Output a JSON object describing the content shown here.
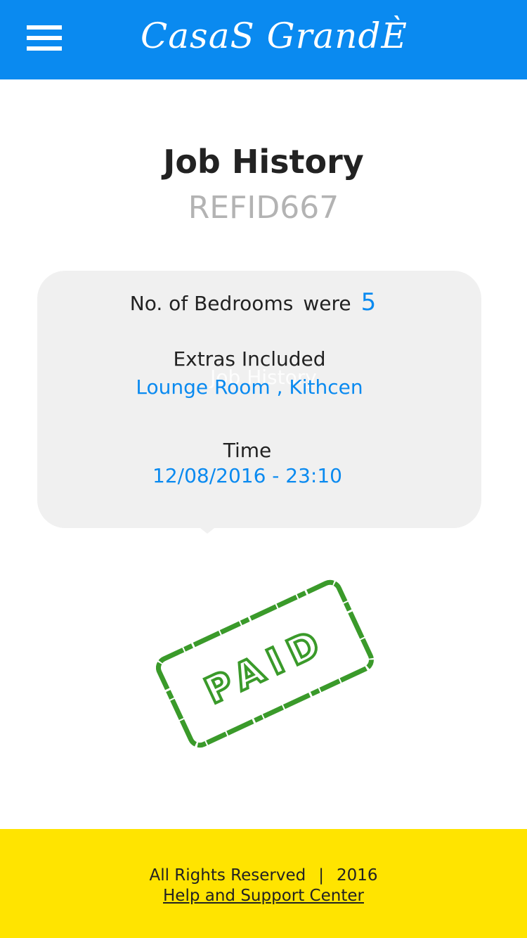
{
  "header": {
    "brand": "CasaS GrandÈ",
    "menu_icon": "hamburger-menu-icon",
    "background": "#0a8af0"
  },
  "job": {
    "title": "Job History",
    "reference_id": "REFID667",
    "bedrooms_label": "No. of Bedrooms",
    "bedrooms_were": "were",
    "bedrooms_value": "5",
    "ghost_title": "Job History",
    "extras_label": "Extras Included",
    "extras_value": "Lounge Room , Kithcen",
    "time_label": "Time",
    "time_value": "12/08/2016 - 23:10"
  },
  "stamp": {
    "text": "PAID",
    "color": "#3a9a2a"
  },
  "footer": {
    "rights": "All Rights Reserved",
    "separator": "|",
    "year": "2016",
    "support_link": "Help and Support Center",
    "background": "#ffe400"
  }
}
